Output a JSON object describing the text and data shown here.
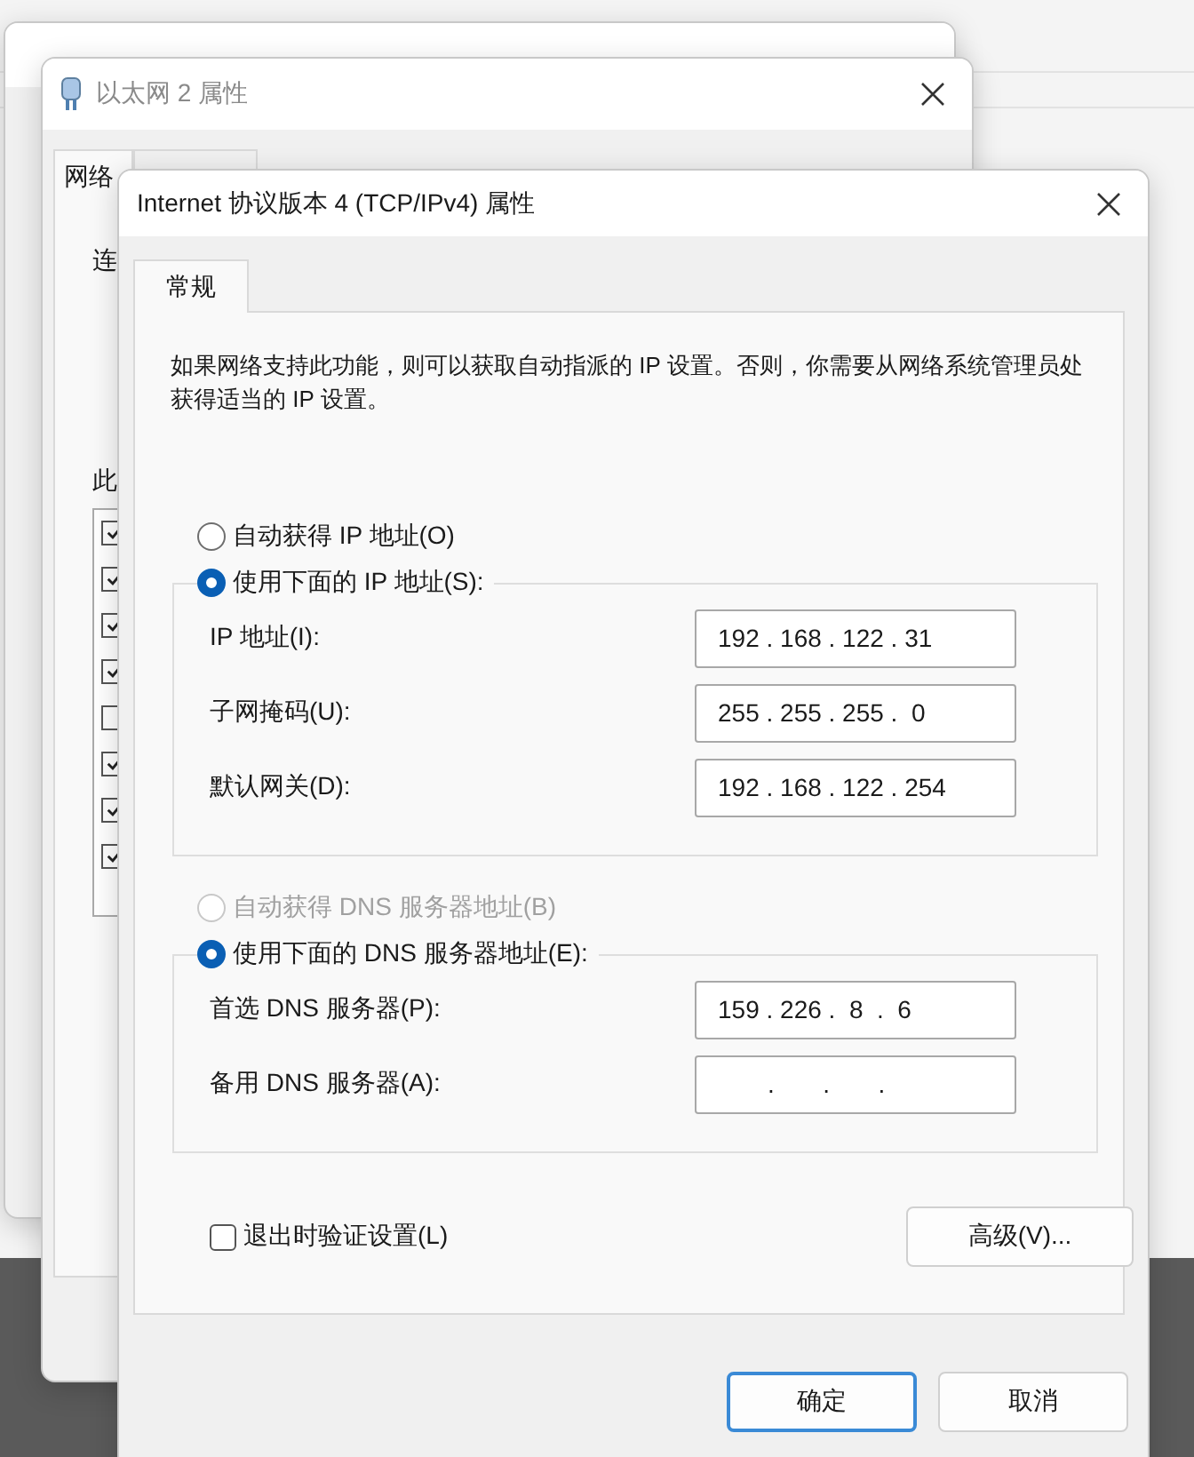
{
  "properties_window": {
    "title": "以太网 2 属性",
    "tabs": [
      {
        "label": "网络",
        "selected": true
      }
    ],
    "labels": [
      "连",
      "此"
    ],
    "components": [
      {
        "checked": true
      },
      {
        "checked": true
      },
      {
        "checked": true
      },
      {
        "checked": true
      },
      {
        "checked": false
      },
      {
        "checked": true
      },
      {
        "checked": true
      },
      {
        "checked": true
      }
    ]
  },
  "dialog": {
    "title": "Internet 协议版本 4 (TCP/IPv4) 属性",
    "tabs": [
      {
        "label": "常规",
        "selected": true
      }
    ],
    "description": "如果网络支持此功能，则可以获取自动指派的 IP 设置。否则，你需要从网络系统管理员处获得适当的 IP 设置。",
    "ip_options": [
      {
        "label": "自动获得 IP 地址(O)",
        "selected": false,
        "disabled": false
      },
      {
        "label": "使用下面的 IP 地址(S):",
        "selected": true,
        "disabled": false
      }
    ],
    "ip_fields": [
      {
        "label": "IP 地址(I):",
        "value": "192 . 168 . 122 . 31"
      },
      {
        "label": "子网掩码(U):",
        "value": "255 . 255 . 255 .  0"
      },
      {
        "label": "默认网关(D):",
        "value": "192 . 168 . 122 . 254"
      }
    ],
    "dns_options": [
      {
        "label": "自动获得 DNS 服务器地址(B)",
        "selected": false,
        "disabled": true
      },
      {
        "label": "使用下面的 DNS 服务器地址(E):",
        "selected": true,
        "disabled": false
      }
    ],
    "dns_fields": [
      {
        "label": "首选 DNS 服务器(P):",
        "value": "159 . 226 .  8  .  6"
      },
      {
        "label": "备用 DNS 服务器(A):",
        "value": ".       .       ."
      }
    ],
    "validate_on_exit": {
      "label": "退出时验证设置(L)",
      "checked": false
    },
    "advanced_button": "高级(V)...",
    "buttons": [
      {
        "label": "确定",
        "default": true
      },
      {
        "label": "取消",
        "default": false
      }
    ]
  }
}
